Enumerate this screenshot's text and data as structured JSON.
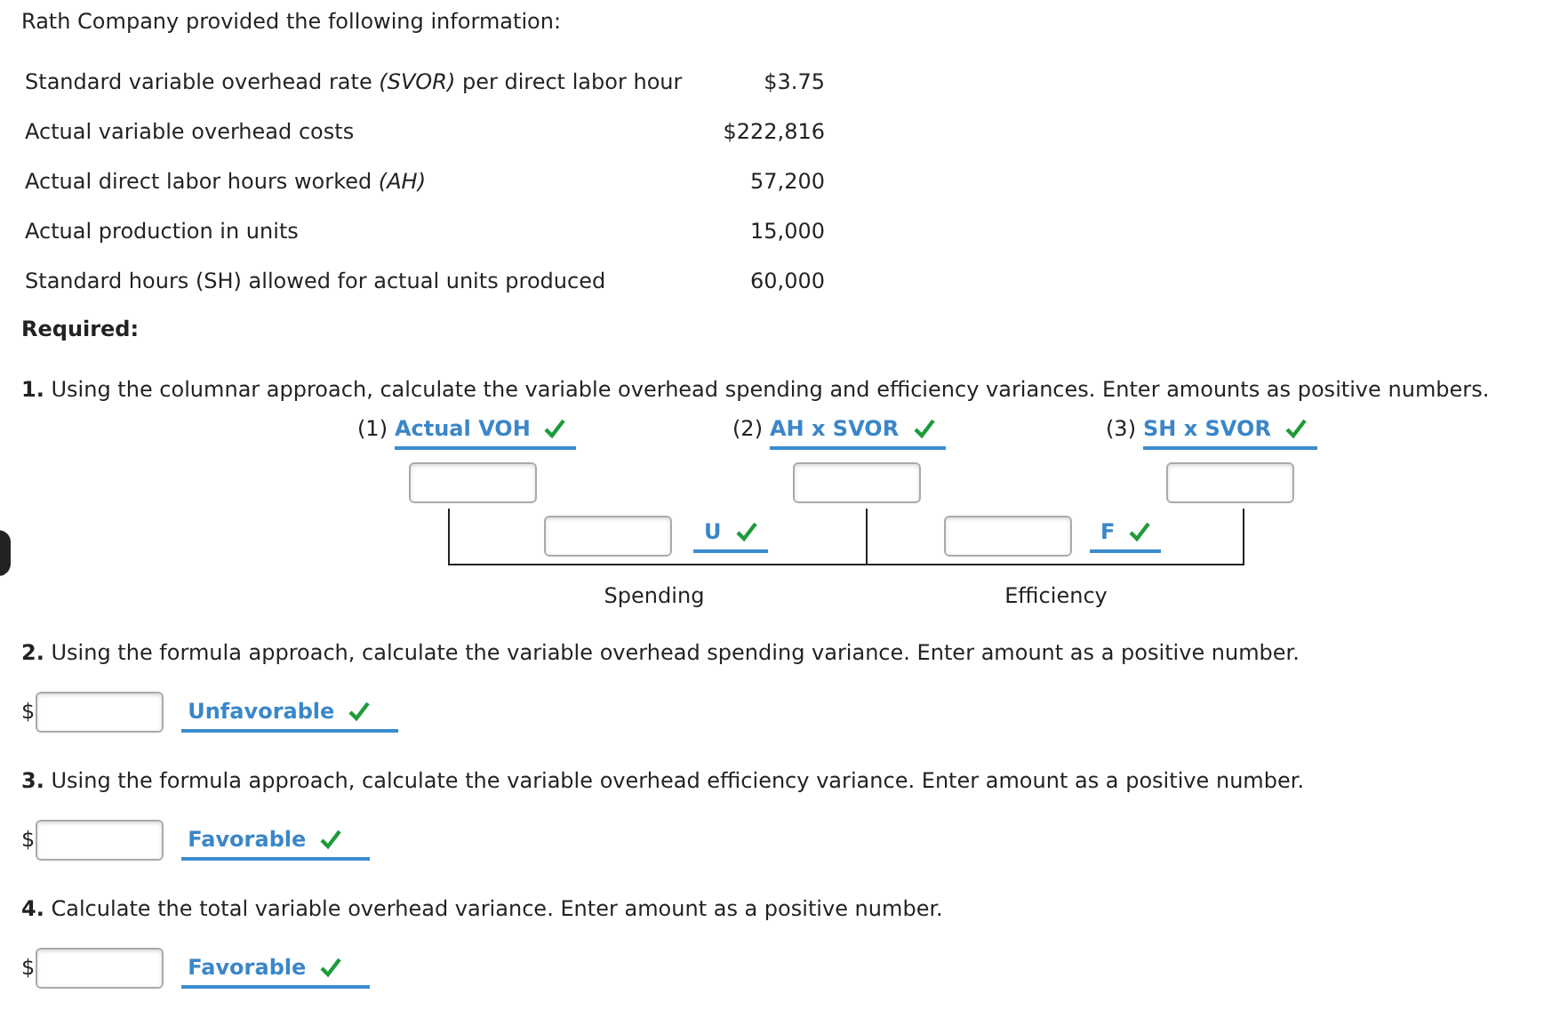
{
  "intro": "Rath Company provided the following information:",
  "facts": [
    {
      "label": "Standard variable overhead rate *(SVOR)* per direct labor hour",
      "value": "$3.75"
    },
    {
      "label": "Actual variable overhead costs",
      "value": "$222,816"
    },
    {
      "label": "Actual direct labor hours worked *(AH)*",
      "value": "57,200"
    },
    {
      "label": "Actual production in units",
      "value": "15,000"
    },
    {
      "label": "Standard hours (SH) allowed for actual units produced",
      "value": "60,000"
    }
  ],
  "required": "Required:",
  "q1": {
    "prompt": "**1.** Using the columnar approach, calculate the variable overhead spending and efficiency variances. Enter amounts as positive numbers.",
    "columns": [
      {
        "number": "(1)",
        "choice": "Actual VOH",
        "correct": true
      },
      {
        "number": "(2)",
        "choice": "AH x SVOR",
        "correct": true
      },
      {
        "number": "(3)",
        "choice": "SH x SVOR",
        "correct": true
      }
    ],
    "variances": [
      {
        "choice": "U",
        "correct": true,
        "label": "Spending"
      },
      {
        "choice": "F",
        "correct": true,
        "label": "Efficiency"
      }
    ]
  },
  "questions": [
    {
      "prompt": "**2.** Using the formula approach, calculate the variable overhead spending variance. Enter amount as a positive number.",
      "currency": "$",
      "choice": "Unfavorable",
      "correct": true
    },
    {
      "prompt": "**3.** Using the formula approach, calculate the variable overhead efficiency variance. Enter amount as a positive number.",
      "currency": "$",
      "choice": "Favorable",
      "correct": true
    },
    {
      "prompt": "**4.** Calculate the total variable overhead variance. Enter amount as a positive number.",
      "currency": "$",
      "choice": "Favorable",
      "correct": true
    }
  ]
}
